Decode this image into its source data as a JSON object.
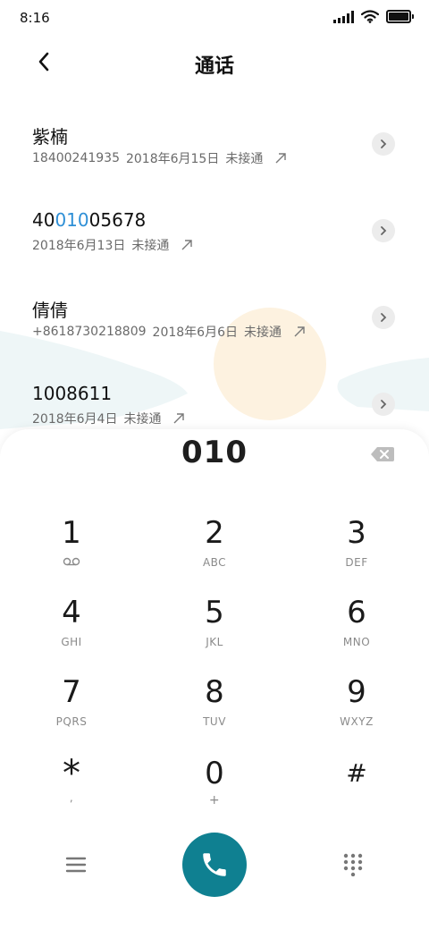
{
  "status": {
    "time": "8:16",
    "battery_level": 0.92
  },
  "header": {
    "title": "通话"
  },
  "calls": [
    {
      "name": "紫楠",
      "number": "18400241935",
      "date": "2018年6月15日",
      "status": "未接通"
    },
    {
      "name_pre": "40",
      "name_hl": "010",
      "name_post": "05678",
      "date": "2018年6月13日",
      "status": "未接通"
    },
    {
      "name": "倩倩",
      "number": "+8618730218809",
      "date": "2018年6月6日",
      "status": "未接通"
    },
    {
      "name": "1008611",
      "date": "2018年6月4日",
      "status": "未接通"
    }
  ],
  "dialer": {
    "entered": "010",
    "keys": [
      {
        "digit": "1",
        "letters": ""
      },
      {
        "digit": "2",
        "letters": "ABC"
      },
      {
        "digit": "3",
        "letters": "DEF"
      },
      {
        "digit": "4",
        "letters": "GHI"
      },
      {
        "digit": "5",
        "letters": "JKL"
      },
      {
        "digit": "6",
        "letters": "MNO"
      },
      {
        "digit": "7",
        "letters": "PQRS"
      },
      {
        "digit": "8",
        "letters": "TUV"
      },
      {
        "digit": "9",
        "letters": "WXYZ"
      },
      {
        "digit": "*",
        "letters": ","
      },
      {
        "digit": "0",
        "letters": "+"
      },
      {
        "digit": "#",
        "letters": ""
      }
    ]
  },
  "colors": {
    "accent": "#0f8091",
    "highlight": "#2e8fd6"
  }
}
